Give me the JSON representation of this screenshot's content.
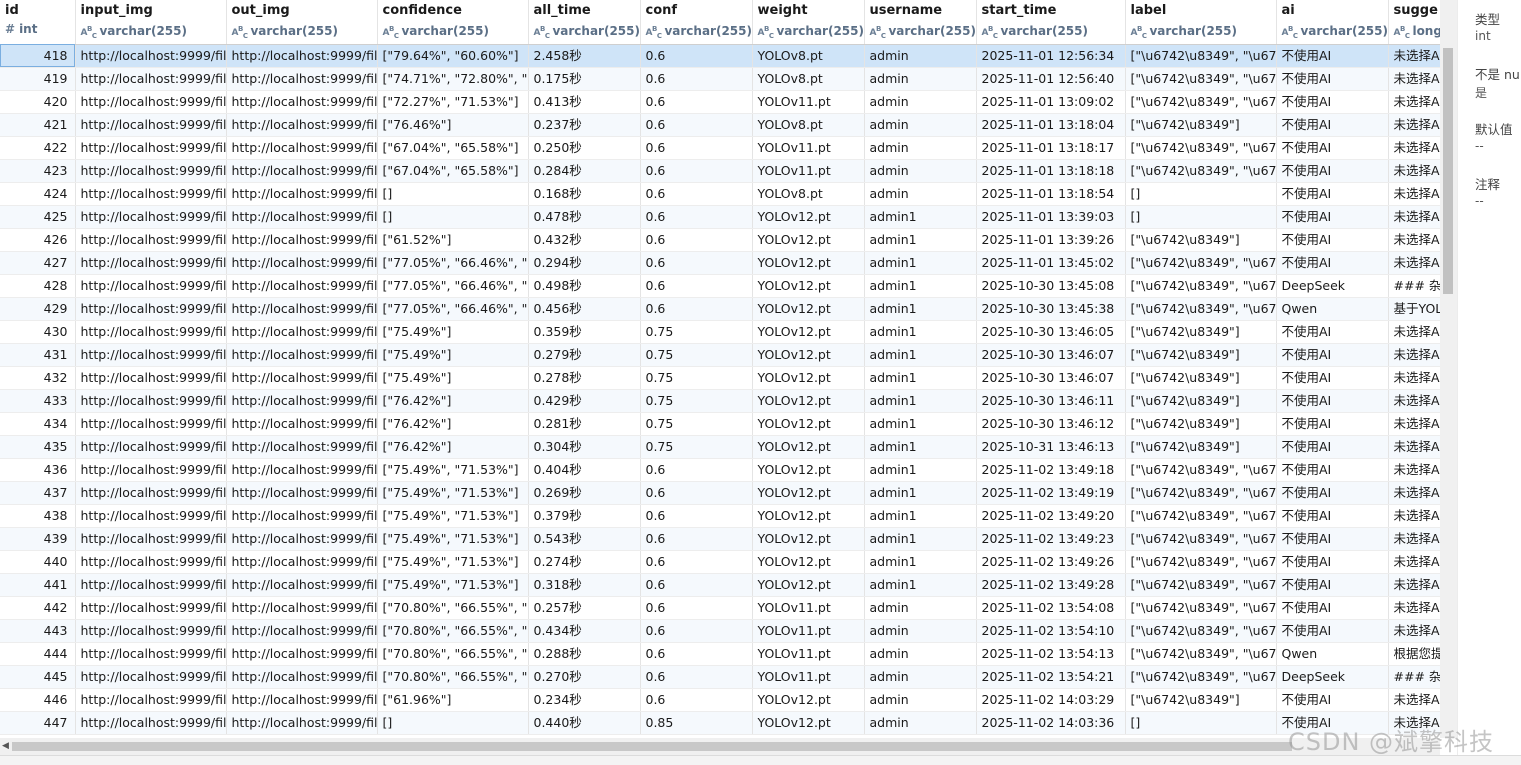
{
  "columns": [
    {
      "name": "id",
      "type": "int",
      "type_icon": "#"
    },
    {
      "name": "input_img",
      "type": "varchar(255)",
      "type_icon": "ABC"
    },
    {
      "name": "out_img",
      "type": "varchar(255)",
      "type_icon": "ABC"
    },
    {
      "name": "confidence",
      "type": "varchar(255)",
      "type_icon": "ABC"
    },
    {
      "name": "all_time",
      "type": "varchar(255)",
      "type_icon": "ABC"
    },
    {
      "name": "conf",
      "type": "varchar(255)",
      "type_icon": "ABC"
    },
    {
      "name": "weight",
      "type": "varchar(255)",
      "type_icon": "ABC"
    },
    {
      "name": "username",
      "type": "varchar(255)",
      "type_icon": "ABC"
    },
    {
      "name": "start_time",
      "type": "varchar(255)",
      "type_icon": "ABC"
    },
    {
      "name": "label",
      "type": "varchar(255)",
      "type_icon": "ABC"
    },
    {
      "name": "ai",
      "type": "varchar(255)",
      "type_icon": "ABC"
    },
    {
      "name": "sugge",
      "type": "long",
      "type_icon": "ABC"
    }
  ],
  "rows": [
    [
      "418",
      "http://localhost:9999/file",
      "http://localhost:9999/file",
      "[\"79.64%\", \"60.60%\"]",
      "2.458秒",
      "0.6",
      "YOLOv8.pt",
      "admin",
      "2025-11-01 12:56:34",
      "[\"\\u6742\\u8349\", \"\\u674",
      "不使用AI",
      "未选择A"
    ],
    [
      "419",
      "http://localhost:9999/file",
      "http://localhost:9999/file",
      "[\"74.71%\", \"72.80%\", \"67",
      "0.175秒",
      "0.6",
      "YOLOv8.pt",
      "admin",
      "2025-11-01 12:56:40",
      "[\"\\u6742\\u8349\", \"\\u674",
      "不使用AI",
      "未选择A"
    ],
    [
      "420",
      "http://localhost:9999/file",
      "http://localhost:9999/file",
      "[\"72.27%\", \"71.53%\"]",
      "0.413秒",
      "0.6",
      "YOLOv11.pt",
      "admin",
      "2025-11-01 13:09:02",
      "[\"\\u6742\\u8349\", \"\\u674",
      "不使用AI",
      "未选择A"
    ],
    [
      "421",
      "http://localhost:9999/file",
      "http://localhost:9999/file",
      "[\"76.46%\"]",
      "0.237秒",
      "0.6",
      "YOLOv8.pt",
      "admin",
      "2025-11-01 13:18:04",
      "[\"\\u6742\\u8349\"]",
      "不使用AI",
      "未选择A"
    ],
    [
      "422",
      "http://localhost:9999/file",
      "http://localhost:9999/file",
      "[\"67.04%\", \"65.58%\"]",
      "0.250秒",
      "0.6",
      "YOLOv11.pt",
      "admin",
      "2025-11-01 13:18:17",
      "[\"\\u6742\\u8349\", \"\\u674",
      "不使用AI",
      "未选择A"
    ],
    [
      "423",
      "http://localhost:9999/file",
      "http://localhost:9999/file",
      "[\"67.04%\", \"65.58%\"]",
      "0.284秒",
      "0.6",
      "YOLOv11.pt",
      "admin",
      "2025-11-01 13:18:18",
      "[\"\\u6742\\u8349\", \"\\u674",
      "不使用AI",
      "未选择A"
    ],
    [
      "424",
      "http://localhost:9999/file",
      "http://localhost:9999/file",
      "[]",
      "0.168秒",
      "0.6",
      "YOLOv8.pt",
      "admin",
      "2025-11-01 13:18:54",
      "[]",
      "不使用AI",
      "未选择A"
    ],
    [
      "425",
      "http://localhost:9999/file",
      "http://localhost:9999/file",
      "[]",
      "0.478秒",
      "0.6",
      "YOLOv12.pt",
      "admin1",
      "2025-11-01 13:39:03",
      "[]",
      "不使用AI",
      "未选择A"
    ],
    [
      "426",
      "http://localhost:9999/file",
      "http://localhost:9999/file",
      "[\"61.52%\"]",
      "0.432秒",
      "0.6",
      "YOLOv12.pt",
      "admin1",
      "2025-11-01 13:39:26",
      "[\"\\u6742\\u8349\"]",
      "不使用AI",
      "未选择A"
    ],
    [
      "427",
      "http://localhost:9999/file",
      "http://localhost:9999/file",
      "[\"77.05%\", \"66.46%\", \"65",
      "0.294秒",
      "0.6",
      "YOLOv12.pt",
      "admin1",
      "2025-11-01 13:45:02",
      "[\"\\u6742\\u8349\", \"\\u674",
      "不使用AI",
      "未选择A"
    ],
    [
      "428",
      "http://localhost:9999/file",
      "http://localhost:9999/file",
      "[\"77.05%\", \"66.46%\", \"65",
      "0.498秒",
      "0.6",
      "YOLOv12.pt",
      "admin1",
      "2025-10-30 13:45:08",
      "[\"\\u6742\\u8349\", \"\\u674",
      "DeepSeek",
      "### 杂草"
    ],
    [
      "429",
      "http://localhost:9999/file",
      "http://localhost:9999/file",
      "[\"77.05%\", \"66.46%\", \"65",
      "0.456秒",
      "0.6",
      "YOLOv12.pt",
      "admin1",
      "2025-10-30 13:45:38",
      "[\"\\u6742\\u8349\", \"\\u674",
      "Qwen",
      "基于YOL"
    ],
    [
      "430",
      "http://localhost:9999/file",
      "http://localhost:9999/file",
      "[\"75.49%\"]",
      "0.359秒",
      "0.75",
      "YOLOv12.pt",
      "admin1",
      "2025-10-30 13:46:05",
      "[\"\\u6742\\u8349\"]",
      "不使用AI",
      "未选择A"
    ],
    [
      "431",
      "http://localhost:9999/file",
      "http://localhost:9999/file",
      "[\"75.49%\"]",
      "0.279秒",
      "0.75",
      "YOLOv12.pt",
      "admin1",
      "2025-10-30 13:46:07",
      "[\"\\u6742\\u8349\"]",
      "不使用AI",
      "未选择A"
    ],
    [
      "432",
      "http://localhost:9999/file",
      "http://localhost:9999/file",
      "[\"75.49%\"]",
      "0.278秒",
      "0.75",
      "YOLOv12.pt",
      "admin1",
      "2025-10-30 13:46:07",
      "[\"\\u6742\\u8349\"]",
      "不使用AI",
      "未选择A"
    ],
    [
      "433",
      "http://localhost:9999/file",
      "http://localhost:9999/file",
      "[\"76.42%\"]",
      "0.429秒",
      "0.75",
      "YOLOv12.pt",
      "admin1",
      "2025-10-30 13:46:11",
      "[\"\\u6742\\u8349\"]",
      "不使用AI",
      "未选择A"
    ],
    [
      "434",
      "http://localhost:9999/file",
      "http://localhost:9999/file",
      "[\"76.42%\"]",
      "0.281秒",
      "0.75",
      "YOLOv12.pt",
      "admin1",
      "2025-10-30 13:46:12",
      "[\"\\u6742\\u8349\"]",
      "不使用AI",
      "未选择A"
    ],
    [
      "435",
      "http://localhost:9999/file",
      "http://localhost:9999/file",
      "[\"76.42%\"]",
      "0.304秒",
      "0.75",
      "YOLOv12.pt",
      "admin1",
      "2025-10-31 13:46:13",
      "[\"\\u6742\\u8349\"]",
      "不使用AI",
      "未选择A"
    ],
    [
      "436",
      "http://localhost:9999/file",
      "http://localhost:9999/file",
      "[\"75.49%\", \"71.53%\"]",
      "0.404秒",
      "0.6",
      "YOLOv12.pt",
      "admin1",
      "2025-11-02 13:49:18",
      "[\"\\u6742\\u8349\", \"\\u674",
      "不使用AI",
      "未选择A"
    ],
    [
      "437",
      "http://localhost:9999/file",
      "http://localhost:9999/file",
      "[\"75.49%\", \"71.53%\"]",
      "0.269秒",
      "0.6",
      "YOLOv12.pt",
      "admin1",
      "2025-11-02 13:49:19",
      "[\"\\u6742\\u8349\", \"\\u674",
      "不使用AI",
      "未选择A"
    ],
    [
      "438",
      "http://localhost:9999/file",
      "http://localhost:9999/file",
      "[\"75.49%\", \"71.53%\"]",
      "0.379秒",
      "0.6",
      "YOLOv12.pt",
      "admin1",
      "2025-11-02 13:49:20",
      "[\"\\u6742\\u8349\", \"\\u674",
      "不使用AI",
      "未选择A"
    ],
    [
      "439",
      "http://localhost:9999/file",
      "http://localhost:9999/file",
      "[\"75.49%\", \"71.53%\"]",
      "0.543秒",
      "0.6",
      "YOLOv12.pt",
      "admin1",
      "2025-11-02 13:49:23",
      "[\"\\u6742\\u8349\", \"\\u674",
      "不使用AI",
      "未选择A"
    ],
    [
      "440",
      "http://localhost:9999/file",
      "http://localhost:9999/file",
      "[\"75.49%\", \"71.53%\"]",
      "0.274秒",
      "0.6",
      "YOLOv12.pt",
      "admin1",
      "2025-11-02 13:49:26",
      "[\"\\u6742\\u8349\", \"\\u674",
      "不使用AI",
      "未选择A"
    ],
    [
      "441",
      "http://localhost:9999/file",
      "http://localhost:9999/file",
      "[\"75.49%\", \"71.53%\"]",
      "0.318秒",
      "0.6",
      "YOLOv12.pt",
      "admin1",
      "2025-11-02 13:49:28",
      "[\"\\u6742\\u8349\", \"\\u674",
      "不使用AI",
      "未选择A"
    ],
    [
      "442",
      "http://localhost:9999/file",
      "http://localhost:9999/file",
      "[\"70.80%\", \"66.55%\", \"66",
      "0.257秒",
      "0.6",
      "YOLOv11.pt",
      "admin",
      "2025-11-02 13:54:08",
      "[\"\\u6742\\u8349\", \"\\u674",
      "不使用AI",
      "未选择A"
    ],
    [
      "443",
      "http://localhost:9999/file",
      "http://localhost:9999/file",
      "[\"70.80%\", \"66.55%\", \"66",
      "0.434秒",
      "0.6",
      "YOLOv11.pt",
      "admin",
      "2025-11-02 13:54:10",
      "[\"\\u6742\\u8349\", \"\\u674",
      "不使用AI",
      "未选择A"
    ],
    [
      "444",
      "http://localhost:9999/file",
      "http://localhost:9999/file",
      "[\"70.80%\", \"66.55%\", \"66",
      "0.288秒",
      "0.6",
      "YOLOv11.pt",
      "admin",
      "2025-11-02 13:54:13",
      "[\"\\u6742\\u8349\", \"\\u674",
      "Qwen",
      "根据您提"
    ],
    [
      "445",
      "http://localhost:9999/file",
      "http://localhost:9999/file",
      "[\"70.80%\", \"66.55%\", \"66",
      "0.270秒",
      "0.6",
      "YOLOv11.pt",
      "admin",
      "2025-11-02 13:54:21",
      "[\"\\u6742\\u8349\", \"\\u674",
      "DeepSeek",
      "### 杂草"
    ],
    [
      "446",
      "http://localhost:9999/file",
      "http://localhost:9999/file",
      "[\"61.96%\"]",
      "0.234秒",
      "0.6",
      "YOLOv12.pt",
      "admin",
      "2025-11-02 14:03:29",
      "[\"\\u6742\\u8349\"]",
      "不使用AI",
      "未选择A"
    ],
    [
      "447",
      "http://localhost:9999/file",
      "http://localhost:9999/file",
      "[]",
      "0.440秒",
      "0.85",
      "YOLOv12.pt",
      "admin",
      "2025-11-02 14:03:36",
      "[]",
      "不使用AI",
      "未选择A"
    ]
  ],
  "selected_row_id": "418",
  "side_panel": {
    "type_label": "类型",
    "type_value": "int",
    "not_null_label": "不是 nu",
    "not_null_value": "是",
    "default_label": "默认值",
    "default_value": "--",
    "comment_label": "注释",
    "comment_value": "--"
  },
  "watermark": "CSDN @斌擎科技"
}
